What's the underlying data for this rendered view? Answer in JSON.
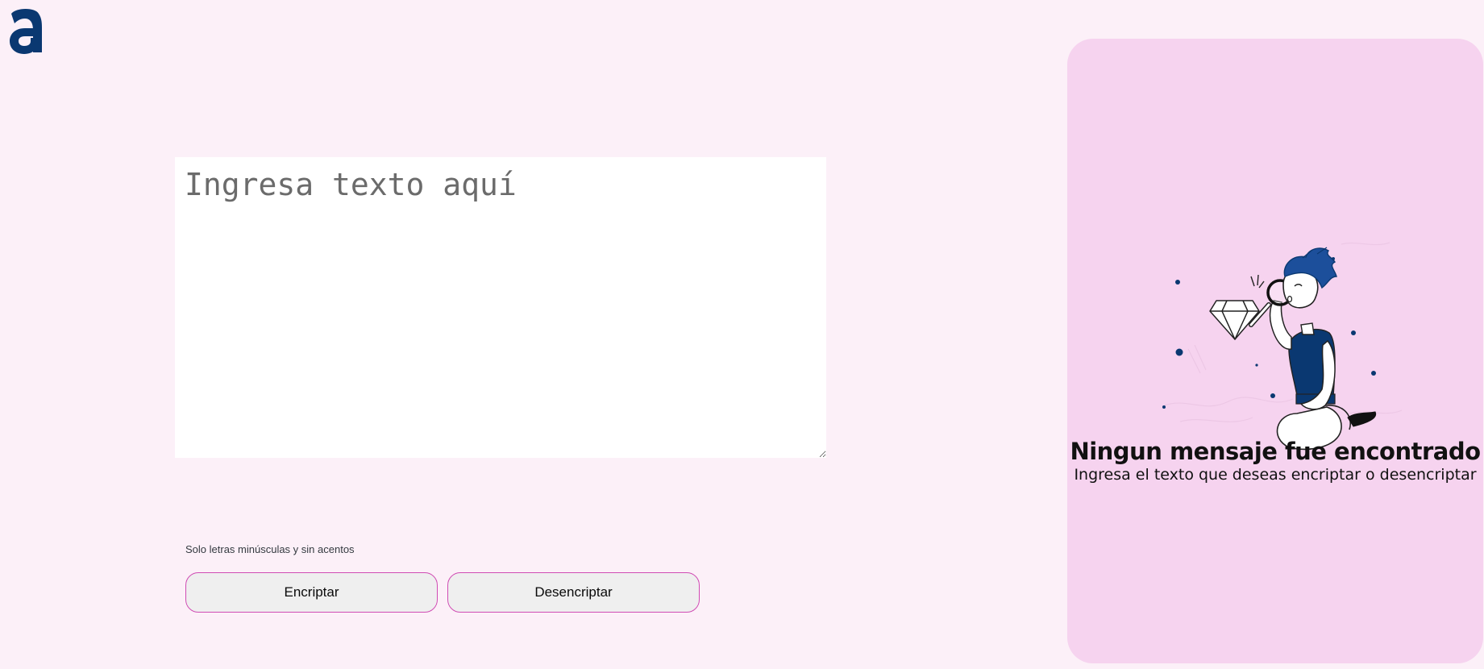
{
  "logo": {
    "icon": "alura-a-logo-icon",
    "color": "#0a3871"
  },
  "input": {
    "placeholder": "Ingresa texto aquí",
    "value": ""
  },
  "hint": {
    "text": "Solo letras minúsculas y sin acentos",
    "icon": "info-icon"
  },
  "buttons": {
    "encrypt_label": "Encriptar",
    "decrypt_label": "Desencriptar"
  },
  "output_panel": {
    "illustration": "person-with-magnifying-glass-illustration",
    "title": "Ningun mensaje fue encontrado",
    "subtitle": "Ingresa el texto que deseas encriptar o desencriptar"
  },
  "colors": {
    "background": "#fcf0f8",
    "panel": "#f6d3ef",
    "accent": "#d04cb4",
    "brand": "#0a3871"
  }
}
